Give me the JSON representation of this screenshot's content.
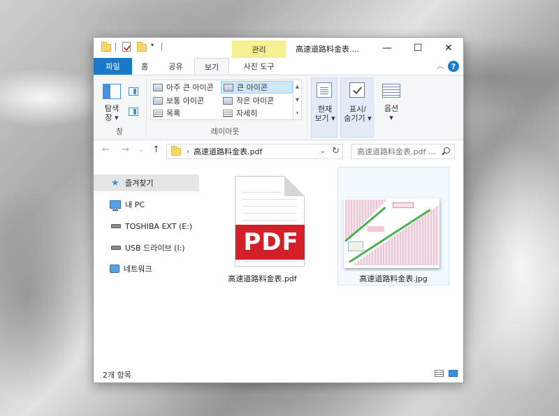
{
  "window": {
    "title": "高速道路料金表....",
    "manage_tab": "관리"
  },
  "ribbon_tabs": [
    "파일",
    "홈",
    "공유",
    "보기",
    "사진 도구"
  ],
  "ribbon": {
    "navpane_label_1": "탐색",
    "navpane_label_2": "창 ▾",
    "pane_group": "창",
    "layout_group": "레이아웃",
    "layout_items": [
      "아주 큰 아이콘",
      "큰 아이콘",
      "보통 아이콘",
      "작은 아이콘",
      "목록",
      "자세히"
    ],
    "current_view_1": "현재",
    "current_view_2": "보기 ▾",
    "show_hide_1": "표시/",
    "show_hide_2": "숨기기 ▾",
    "options_1": "옵션",
    "options_2": "▾"
  },
  "address": {
    "path": "高速道路料金表.pdf",
    "search_placeholder": "高速道路料金表.pdf ..."
  },
  "nav_items": [
    "즐겨찾기",
    "내 PC",
    "TOSHIBA EXT (E:)",
    "USB 드라이브 (I:)",
    "네트워크"
  ],
  "files": [
    {
      "name": "高速道路料金表.pdf",
      "badge": "PDF"
    },
    {
      "name": "高速道路料金表.jpg"
    }
  ],
  "status": {
    "count": "2개 항목"
  },
  "colors": {
    "accent": "#1979ca",
    "manage_tab": "#f6ef91",
    "pdf_red": "#d32028"
  }
}
